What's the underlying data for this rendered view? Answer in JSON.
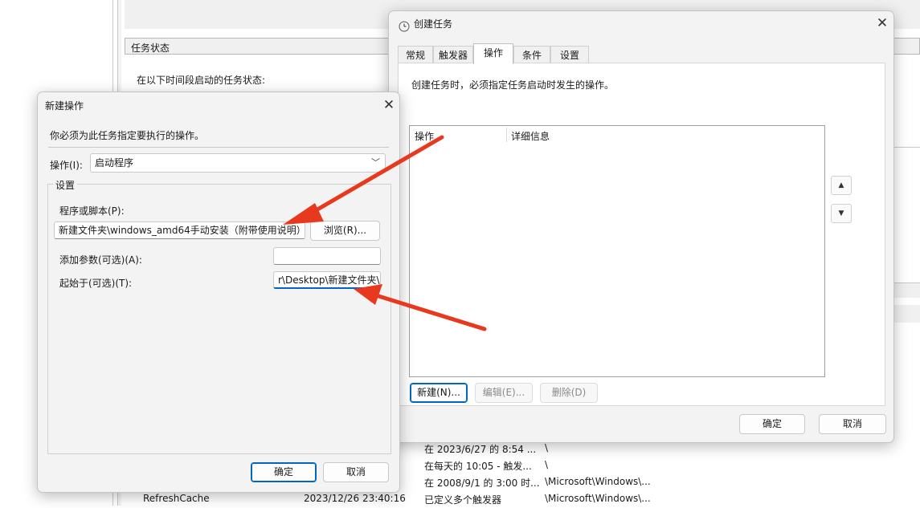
{
  "background": {
    "task_status_header": "任务状态",
    "task_status_text": "在以下时间段启动的任务状态:",
    "rows": [
      {
        "name": "",
        "time": "",
        "trigger": "在 2023/6/27 的 8:54 ...",
        "path": "\\"
      },
      {
        "name": "",
        "time": "",
        "trigger": "在每天的 10:05 - 触发...",
        "path": "\\"
      },
      {
        "name": "",
        "time": "",
        "trigger": "在 2008/9/1 的 3:00 时...",
        "path": "\\Microsoft\\Windows\\..."
      },
      {
        "name": "RefreshCache",
        "time": "2023/12/26 23:40:16",
        "trigger": "已定义多个触发器",
        "path": "\\Microsoft\\Windows\\..."
      }
    ]
  },
  "create_task": {
    "title": "创建任务",
    "tabs": [
      "常规",
      "触发器",
      "操作",
      "条件",
      "设置"
    ],
    "active_tab": "操作",
    "description": "创建任务时，必须指定任务启动时发生的操作。",
    "columns": [
      "操作",
      "详细信息"
    ],
    "buttons": {
      "new": "新建(N)...",
      "edit": "编辑(E)...",
      "delete": "删除(D)"
    },
    "up_glyph": "▲",
    "down_glyph": "▼",
    "ok": "确定",
    "cancel": "取消"
  },
  "new_action": {
    "title": "新建操作",
    "instruction": "你必须为此任务指定要执行的操作。",
    "action_label": "操作(I):",
    "action_value": "启动程序",
    "settings_label": "设置",
    "program_label": "程序或脚本(P):",
    "program_value": "新建文件夹\\windows_amd64手动安装（附带使用说明）",
    "browse_button": "浏览(R)...",
    "args_label": "添加参数(可选)(A):",
    "args_value": "",
    "start_in_label": "起始于(可选)(T):",
    "start_in_value": "r\\Desktop\\新建文件夹\\",
    "ok": "确定",
    "cancel": "取消"
  },
  "icons": {
    "close": "close-icon",
    "clock": "clock-icon",
    "dropdown": "chevron-down-icon",
    "arrow": "red-annotation-arrow"
  },
  "colors": {
    "accent": "#0067c0",
    "annotation_arrow": "#e8391e"
  }
}
